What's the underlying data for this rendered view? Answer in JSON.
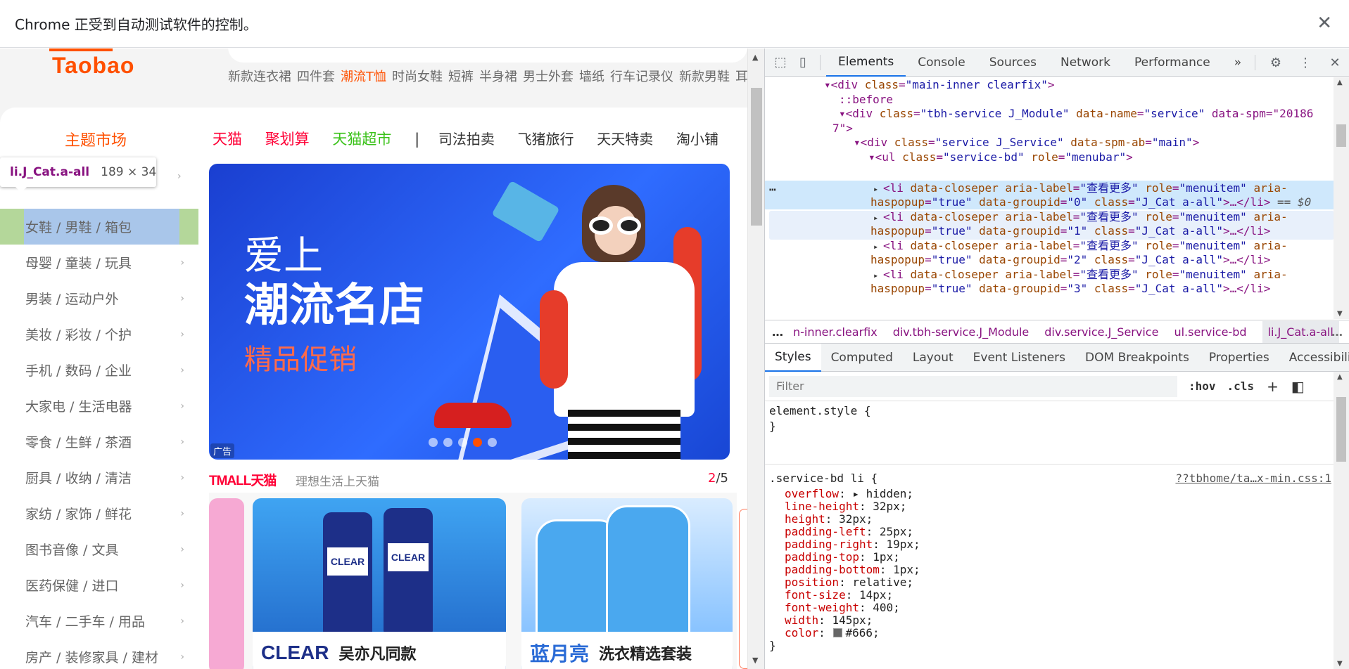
{
  "infobar": {
    "message": "Chrome 正受到自动测试软件的控制。",
    "close_glyph": "✕"
  },
  "page": {
    "logo": "Taobao",
    "hotwords": [
      "新款连衣裙",
      "四件套",
      "潮流T恤",
      "时尚女鞋",
      "短裤",
      "半身裙",
      "男士外套",
      "墙纸",
      "行车记录仪",
      "新款男鞋",
      "耳机"
    ],
    "hot_index": 2,
    "category_title": "主题市场",
    "categories": [
      "女鞋 / 男鞋 / 箱包",
      "母婴 / 童装 / 玩具",
      "男装 / 运动户外",
      "美妆 / 彩妆 / 个护",
      "手机 / 数码 / 企业",
      "大家电 / 生活电器",
      "零食 / 生鲜 / 茶酒",
      "厨具 / 收纳 / 清洁",
      "家纺 / 家饰 / 鲜花",
      "图书音像 / 文具",
      "医药保健 / 进口",
      "汽车 / 二手车 / 用品",
      "房产 / 装修家具 / 建材"
    ],
    "tooltip": {
      "selector": "li.J_Cat.a-all",
      "size": "189 × 34"
    },
    "channels": {
      "tmall": "天猫",
      "juhuasuan": "聚划算",
      "chaoshi": "天猫超市",
      "sep": "|",
      "others": [
        "司法拍卖",
        "飞猪旅行",
        "天天特卖",
        "淘小铺"
      ]
    },
    "banner": {
      "line1": "爱上",
      "line2": "潮流名店",
      "line3": "精品促销",
      "ad_label": "广告",
      "slide_count": 5,
      "active_slide": 4
    },
    "tmall_section": {
      "logo": "TMALL天猫",
      "slogan": "理想生活上天猫",
      "page_current": "2",
      "page_total": "/5",
      "products": [
        {
          "brand": "CLEAR",
          "caption": "吴亦凡同款",
          "bottle_label": "CLEAR"
        },
        {
          "brand": "蓝月亮",
          "caption": "洗衣精选套装"
        }
      ]
    }
  },
  "devtools": {
    "tabs": [
      "Elements",
      "Console",
      "Sources",
      "Network",
      "Performance"
    ],
    "active_tab": "Elements",
    "more_tabs": "»",
    "dom_lines": [
      {
        "indent": 0,
        "html": "▾<div class=\"main-inner clearfix\">"
      },
      {
        "indent": 1,
        "html": "::before"
      },
      {
        "indent": 1,
        "html": "▾<div class=\"tbh-service J_Module\" data-name=\"service\" data-spm=\"20186"
      },
      {
        "indent": 1,
        "html": "7\">"
      },
      {
        "indent": 2,
        "html": "▾<div class=\"service J_Service\" data-spm-ab=\"main\">"
      },
      {
        "indent": 3,
        "html": "▾<ul class=\"service-bd\" role=\"menubar\">"
      }
    ],
    "li_items": [
      {
        "groupid": "0",
        "selected": true
      },
      {
        "groupid": "1",
        "hover": true
      },
      {
        "groupid": "2"
      },
      {
        "groupid": "3"
      }
    ],
    "li_label": "查看更多",
    "selected_marker": "== $0",
    "breadcrumbs": [
      "n-inner.clearfix",
      "div.tbh-service.J_Module",
      "div.service.J_Service",
      "ul.service-bd",
      "li.J_Cat.a-all"
    ],
    "sub_tabs": [
      "Styles",
      "Computed",
      "Layout",
      "Event Listeners",
      "DOM Breakpoints",
      "Properties",
      "Accessibility"
    ],
    "active_sub_tab": "Styles",
    "filter_placeholder": "Filter",
    "hov": ":hov",
    "cls": ".cls",
    "element_style": "element.style {",
    "rule_selector": ".service-bd li {",
    "rule_source": "??tbhome/ta…x-min.css:1",
    "declarations": [
      {
        "prop": "overflow",
        "val": "hidden",
        "expand": true
      },
      {
        "prop": "line-height",
        "val": "32px"
      },
      {
        "prop": "height",
        "val": "32px"
      },
      {
        "prop": "padding-left",
        "val": "25px"
      },
      {
        "prop": "padding-right",
        "val": "19px"
      },
      {
        "prop": "padding-top",
        "val": "1px"
      },
      {
        "prop": "padding-bottom",
        "val": "1px"
      },
      {
        "prop": "position",
        "val": "relative"
      },
      {
        "prop": "font-size",
        "val": "14px"
      },
      {
        "prop": "font-weight",
        "val": "400"
      },
      {
        "prop": "width",
        "val": "145px"
      },
      {
        "prop": "color",
        "val": "#666",
        "swatch": "#666666"
      }
    ]
  },
  "colors": {
    "taobao_orange": "#ff5000",
    "tmall_red": "#ff0036",
    "chaoshi_green": "#3ac219",
    "devtools_accent": "#1a73e8",
    "dom_tag": "#881280",
    "dom_attr_name": "#994500",
    "dom_attr_value": "#1a1aa6",
    "css_prop": "#c80000"
  }
}
